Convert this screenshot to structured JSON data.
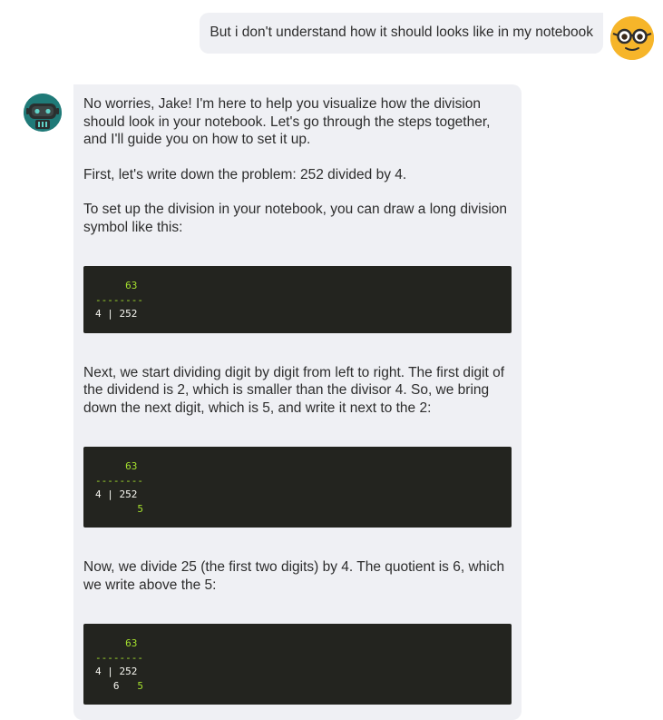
{
  "user_message": {
    "text": "But i don't understand how it should looks like in my notebook",
    "avatar": "nerd-glasses-face-icon"
  },
  "bot_message": {
    "avatar": "robot-icon",
    "paragraphs": {
      "p1": "No worries, Jake! I'm here to help you visualize how the division should look in your notebook. Let's go through the steps together, and I'll guide you on how to set it up.",
      "p2": "First, let's write down the problem: 252 divided by 4.",
      "p3": "To set up the division in your notebook, you can draw a long division symbol like this:",
      "p4": "Next, we start dividing digit by digit from left to right. The first digit of the dividend is 2, which is smaller than the divisor 4. So, we bring down the next digit, which is 5, and write it next to the 2:",
      "p5": "Now, we divide 25 (the first two digits) by 4. The quotient is 6, which we write above the 5:"
    },
    "code_blocks": {
      "block1": {
        "quotient": "63",
        "line": "--------",
        "division": "4 | 252"
      },
      "block2": {
        "quotient": "63",
        "line": "--------",
        "division": "4 | 252",
        "below": "5"
      },
      "block3": {
        "quotient": "63",
        "line": "--------",
        "division": "4 | 252",
        "below_left": "6",
        "below_right": "5"
      }
    }
  },
  "colors": {
    "bubble_bg": "#eff0f4",
    "code_bg": "#23241f",
    "code_text": "#f8f8f2",
    "code_number": "#a6e22e",
    "user_avatar": "#f6b52a",
    "bot_avatar": "#1f7a78"
  }
}
